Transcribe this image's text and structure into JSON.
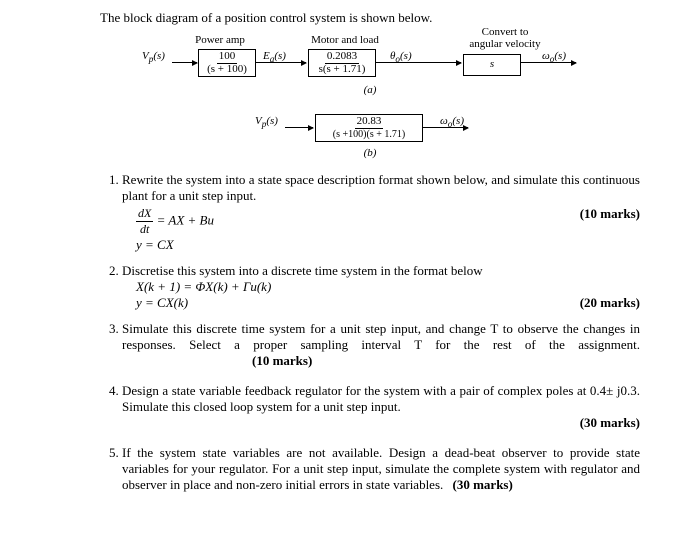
{
  "intro": "The block diagram of a position control system is shown below.",
  "diagA": {
    "labels": {
      "power": "Power amp",
      "motor": "Motor and load",
      "convert": "Convert to\nangular velocity"
    },
    "signals": {
      "vp": "V_p(s)",
      "ea": "E_a(s)",
      "theta": "θ_o(s)",
      "omega": "ω_o(s)"
    },
    "block1": {
      "num": "100",
      "den": "(s + 100)"
    },
    "block2": {
      "num": "0.2083",
      "den": "s(s + 1.71)"
    },
    "block3": "s",
    "sub": "(a)"
  },
  "diagB": {
    "signals": {
      "vp": "V_p(s)",
      "omega": "ω_o(s)"
    },
    "block": {
      "num": "20.83",
      "den": "(s +100)(s + 1.71)"
    },
    "sub": "(b)"
  },
  "q1": {
    "text": "Rewrite the system into a state space description format shown below, and simulate this continuous plant for a unit step input.",
    "eq1n": "dX",
    "eq1d": "dt",
    "eq1r": " = AX + Bu",
    "eq2": "y = CX",
    "marks": "(10 marks)"
  },
  "q2": {
    "text": "Discretise this system into a discrete time system in the format below",
    "eq1": "X(k + 1) = ΦX(k) + Γu(k)",
    "eq2": "y = CX(k)",
    "marks": "(20 marks)"
  },
  "q3": {
    "text1": "Simulate this discrete time system for a unit step input, and change T to observe the changes in responses. Select a proper sampling interval T for the rest of the assignment.",
    "marks": "(10 marks)"
  },
  "q4": {
    "text": "Design a state variable feedback regulator for the system with a pair of complex poles at 0.4± j0.3. Simulate this closed loop system for a unit step input.",
    "marks": "(30 marks)"
  },
  "q5": {
    "text": "If the system state variables are not available. Design a dead-beat observer to provide state variables for your regulator. For a unit step input, simulate the complete system with regulator and observer in place and non-zero initial errors in state variables.",
    "marks": "(30 marks)"
  }
}
